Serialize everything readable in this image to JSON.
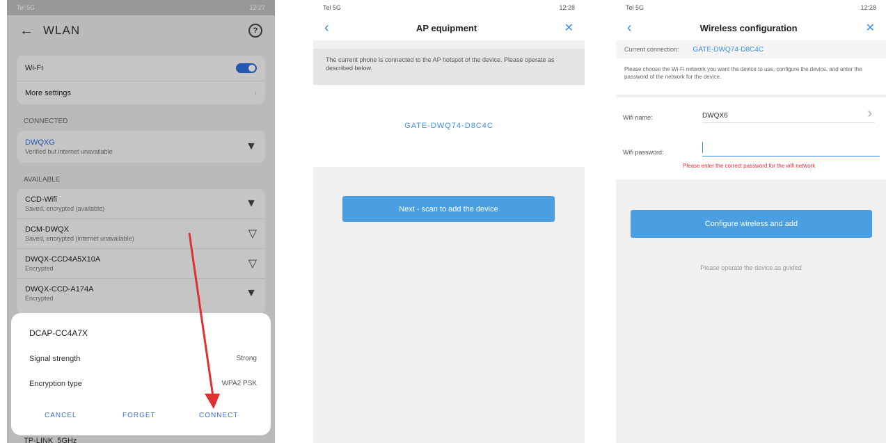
{
  "panel1": {
    "status_left": "Tel 5G",
    "status_right": "12:27",
    "title": "WLAN",
    "wlan_label": "Wi-Fi",
    "more_settings": "More settings",
    "connected_header": "CONNECTED",
    "connected_name": "DWQXG",
    "connected_sub": "Verified but internet unavailable",
    "available_header": "AVAILABLE",
    "networks": [
      {
        "name": "CCD-Wifi",
        "sub": "Saved, encrypted (available)"
      },
      {
        "name": "DCM-DWQX",
        "sub": "Saved, encrypted (internet unavailable)"
      },
      {
        "name": "DWQX-CCD4A5X10A",
        "sub": "Encrypted"
      },
      {
        "name": "DWQX-CCD-A174A",
        "sub": "Encrypted"
      }
    ],
    "dialog": {
      "title": "DCAP-CC4A7X",
      "signal_label": "Signal strength",
      "signal_value": "Strong",
      "encryption_label": "Encryption type",
      "encryption_value": "WPA2 PSK",
      "cancel": "CANCEL",
      "forget": "FORGET",
      "connect": "CONNECT"
    },
    "bottom_peek": "TP-LINK_5GHz",
    "colors": {
      "arrow": "#e03030",
      "dialog_action": "#3a6fd8"
    }
  },
  "panel2": {
    "status_left": "Tel 5G",
    "status_right": "12:28",
    "title": "AP equipment",
    "info": "The current phone is connected to the AP hotspot of the device. Please operate as described below.",
    "ssid": "GATE-DWQ74-D8C4C",
    "button": "Next - scan to add the device"
  },
  "panel3": {
    "status_left": "Tel 5G",
    "status_right": "12:28",
    "title": "Wireless configuration",
    "connected_label": "Current connection:",
    "connected_value": "GATE-DWQ74-D8C4C",
    "info": "Please choose the Wi-Fi network you want the device to use, configure the device, and enter the password of the network for the device.",
    "wifi_name_label": "Wifi name:",
    "wifi_name_value": "DWQX6",
    "wifi_password_label": "Wifi password:",
    "error": "Please enter the correct password for the wifi network",
    "button": "Configure wireless and add",
    "hint": "Please operate the device as guided"
  }
}
